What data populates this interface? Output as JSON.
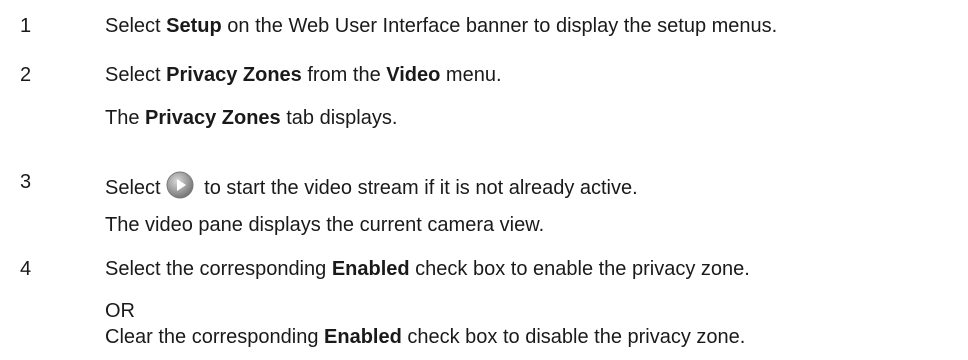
{
  "steps": [
    {
      "number": "1",
      "text": {
        "a": "Select ",
        "b": "Setup",
        "c": " on the Web User Interface banner to display the setup menus."
      }
    },
    {
      "number": "2",
      "text": {
        "a": "Select ",
        "b": "Privacy Zones",
        "c": " from the ",
        "d": "Video",
        "e": " menu."
      },
      "result": {
        "a": "The ",
        "b": "Privacy Zones",
        "c": " tab displays."
      }
    },
    {
      "number": "3",
      "text": {
        "a": "Select",
        "icon": "play-button-icon",
        "b": " to start the video stream if it is not already active."
      },
      "result": "The video pane displays the current camera view."
    },
    {
      "number": "4",
      "text": {
        "a": "Select the corresponding ",
        "b": "Enabled",
        "c": " check box to enable the privacy zone."
      },
      "or": "OR",
      "alt": {
        "a": "Clear the corresponding ",
        "b": "Enabled",
        "c": " check box to disable the privacy zone."
      }
    }
  ]
}
